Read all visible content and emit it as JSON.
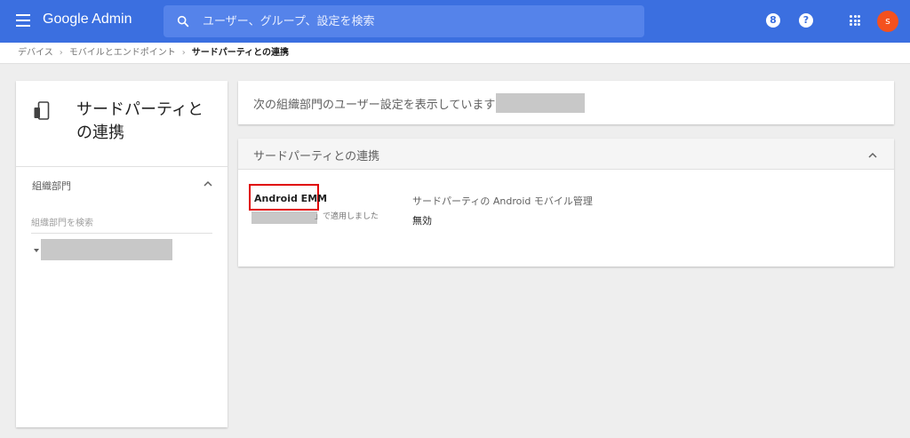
{
  "app": {
    "title": "Google Admin",
    "brand_color": "#3b6fe0"
  },
  "search": {
    "placeholder": "ユーザー、グループ、設定を検索"
  },
  "topbar_icons": {
    "support_icon": "number-8-circle-icon",
    "help_icon": "help-circle-icon",
    "apps_icon": "apps-grid-icon",
    "avatar_initial": "s",
    "avatar_color": "#f4511e"
  },
  "breadcrumb": {
    "items": [
      "デバイス",
      "モバイルとエンドポイント",
      "サードパーティとの連携"
    ],
    "separator": "›"
  },
  "left_panel": {
    "title": "サードパーティとの連携",
    "org_section_label": "組織部門",
    "org_search_placeholder": "組織部門を検索"
  },
  "info_card": {
    "text": "次の組織部門のユーザー設定を表示しています:"
  },
  "settings_card": {
    "title": "サードパーティとの連携",
    "setting": {
      "label": "Android EMM",
      "applied_suffix": "」で適用しました",
      "name": "サードパーティの Android モバイル管理",
      "value": "無効"
    },
    "highlight_color": "#e00000"
  }
}
